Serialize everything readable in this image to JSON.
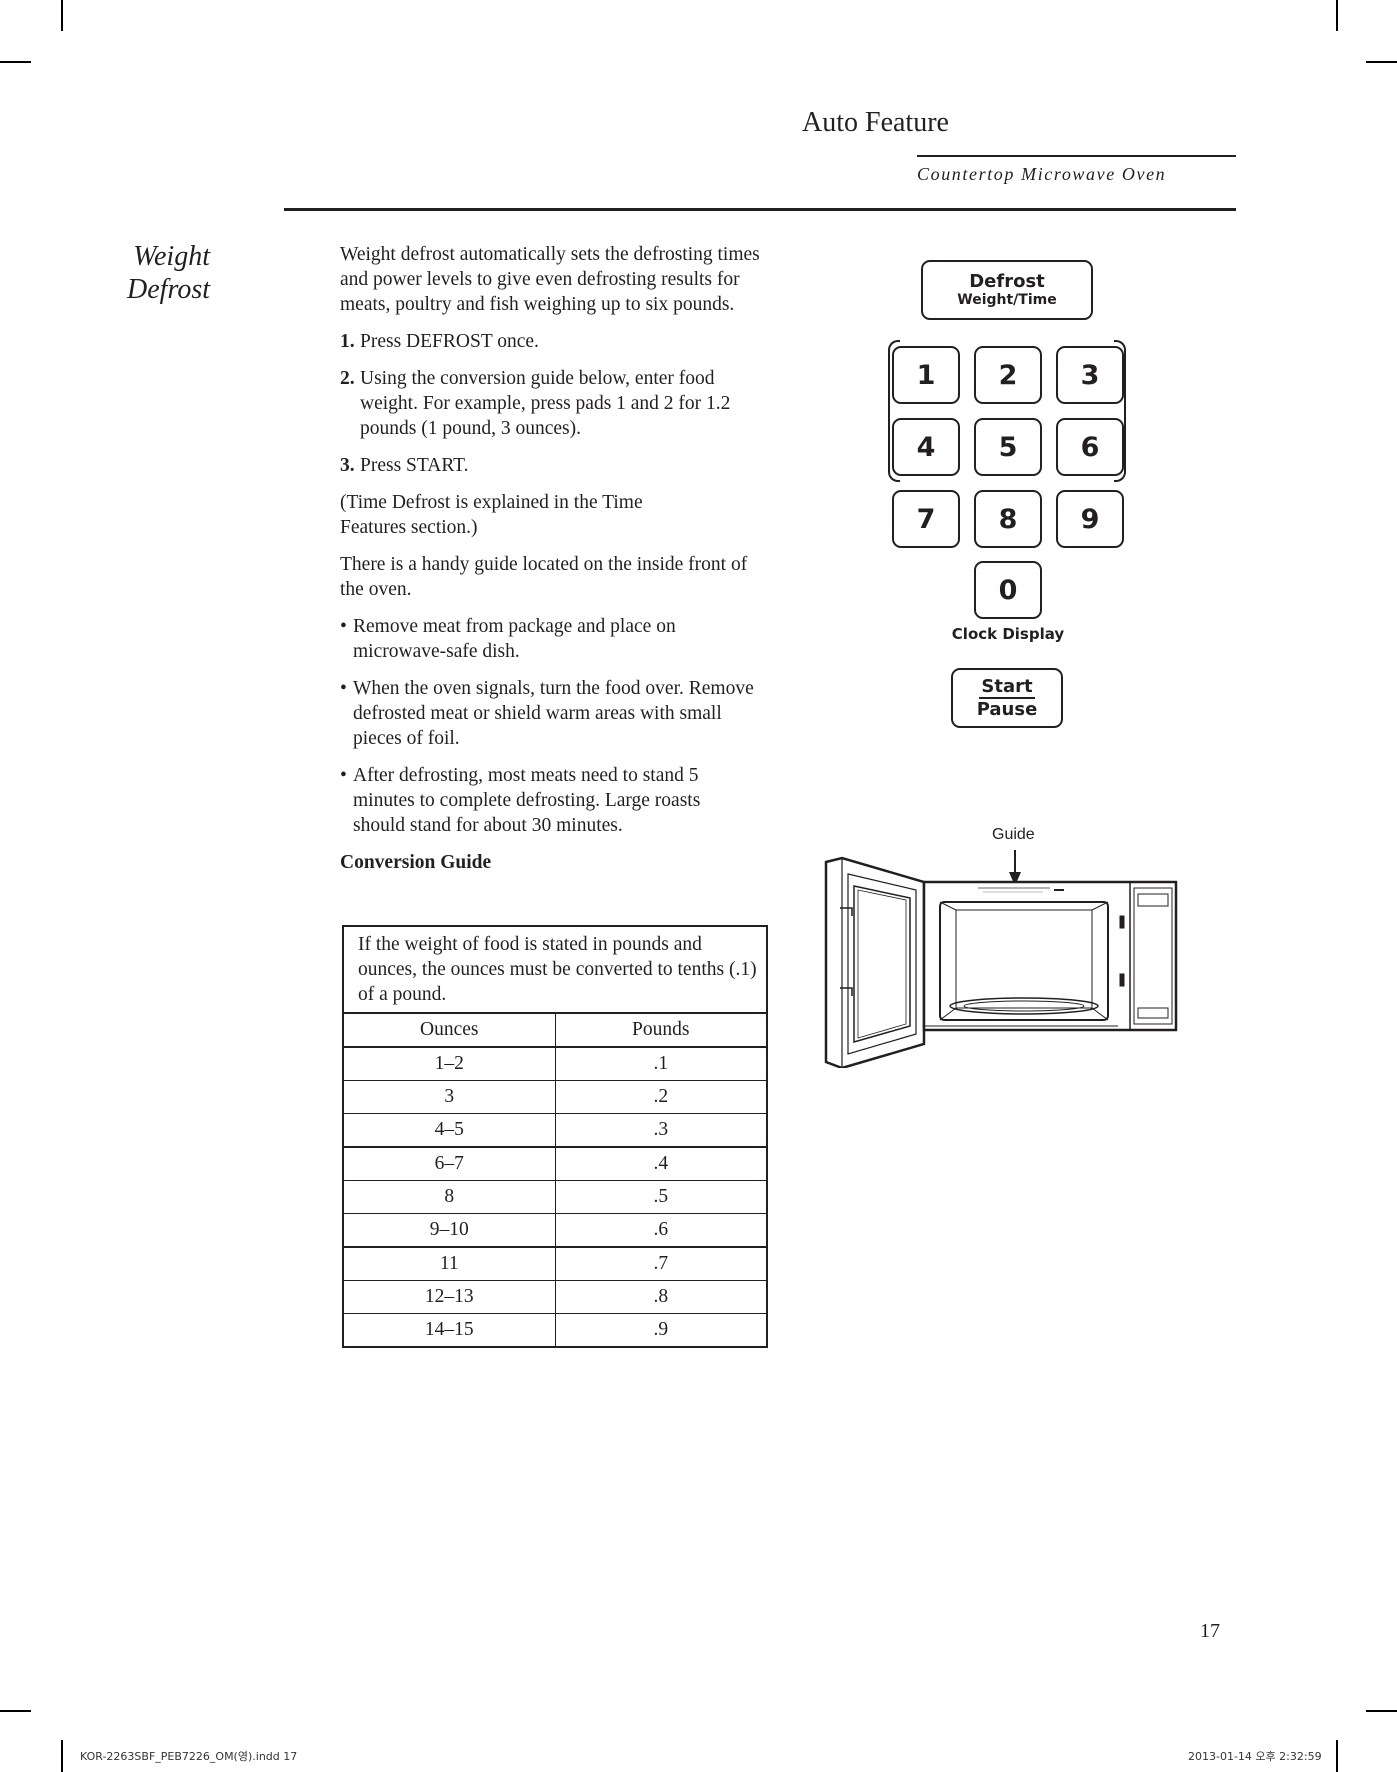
{
  "header": {
    "title": "Auto Feature",
    "subtitle": "Countertop Microwave Oven"
  },
  "section": {
    "title_line1": "Weight",
    "title_line2": "Defrost"
  },
  "body": {
    "intro": "Weight defrost automatically sets the defrosting times and power levels to give even defrosting results for meats, poultry and fish weighing up to six pounds.",
    "steps": [
      {
        "num": "1.",
        "text": "Press DEFROST once."
      },
      {
        "num": "2.",
        "text": "Using the conversion guide below, enter food weight. For example, press pads 1 and 2 for 1.2 pounds (1 pound, 3 ounces)."
      },
      {
        "num": "3.",
        "text": "Press START."
      }
    ],
    "note_time_defrost": "(Time Defrost is explained in the Time Features section.)",
    "note_guide": "There is a handy guide located on the inside front of the oven.",
    "bullets": [
      "Remove meat from package and place on microwave-safe dish.",
      "When the oven signals, turn the food over. Remove defrosted meat or shield warm areas with small pieces of foil.",
      "After defrosting, most meats need to stand 5 minutes to complete defrosting. Large roasts should stand for about 30 minutes."
    ],
    "conversion_title": "Conversion Guide"
  },
  "conversion_table": {
    "note": "If the weight of food is stated in pounds and ounces, the ounces must be converted to tenths (.1) of a pound.",
    "headers": [
      "Ounces",
      "Pounds"
    ],
    "rows": [
      [
        "1–2",
        ".1"
      ],
      [
        "3",
        ".2"
      ],
      [
        "4–5",
        ".3"
      ],
      [
        "6–7",
        ".4"
      ],
      [
        "8",
        ".5"
      ],
      [
        "9–10",
        ".6"
      ],
      [
        "11",
        ".7"
      ],
      [
        "12–13",
        ".8"
      ],
      [
        "14–15",
        ".9"
      ]
    ]
  },
  "control_panel": {
    "defrost_label": "Defrost",
    "defrost_sublabel": "Weight/Time",
    "keys": [
      "1",
      "2",
      "3",
      "4",
      "5",
      "6",
      "7",
      "8",
      "9",
      "0"
    ],
    "clock_label": "Clock Display",
    "start_label": "Start",
    "pause_label": "Pause"
  },
  "illustration": {
    "guide_label": "Guide"
  },
  "page_number": "17",
  "slug": {
    "file": "KOR-2263SBF_PEB7226_OM(영).indd   17",
    "timestamp": "2013-01-14   오후 2:32:59"
  }
}
